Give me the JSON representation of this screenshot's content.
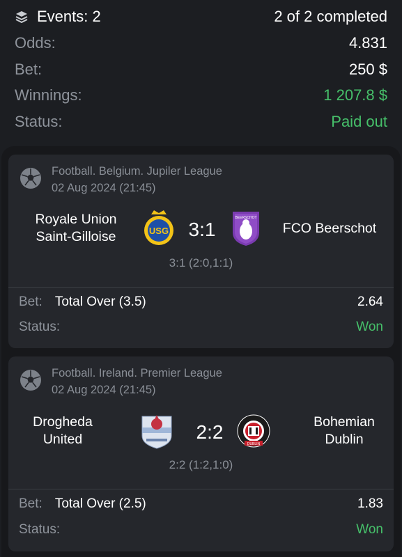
{
  "summary": {
    "events_label": "Events: 2",
    "completed": "2 of 2 completed",
    "odds_label": "Odds:",
    "odds_value": "4.831",
    "bet_label": "Bet:",
    "bet_value": "250 $",
    "winnings_label": "Winnings:",
    "winnings_value": "1 207.8 $",
    "status_label": "Status:",
    "status_value": "Paid out"
  },
  "colors": {
    "accent_green": "#46c06a",
    "muted": "#8e939b",
    "card": "#25272c",
    "background": "#1c1e22"
  },
  "events": [
    {
      "league": "Football. Belgium. Jupiler League",
      "date": "02 Aug 2024 (21:45)",
      "home_line1": "Royale Union",
      "home_line2": "Saint-Gilloise",
      "away_line1": "FCO Beerschot",
      "away_line2": "",
      "home_logo_text": "USG",
      "away_logo_text": "BEERSCHOT",
      "score": "3:1",
      "score_detail": "3:1 (2:0,1:1)",
      "bet_label": "Bet:",
      "bet_type": "Total Over (3.5)",
      "odds": "2.64",
      "status_label": "Status:",
      "status": "Won"
    },
    {
      "league": "Football. Ireland. Premier League",
      "date": "02 Aug 2024 (21:45)",
      "home_line1": "Drogheda",
      "home_line2": "United",
      "away_line1": "Bohemian",
      "away_line2": "Dublin",
      "home_logo_text": "",
      "away_logo_text": "DUBLIN",
      "score": "2:2",
      "score_detail": "2:2 (1:2,1:0)",
      "bet_label": "Bet:",
      "bet_type": "Total Over (2.5)",
      "odds": "1.83",
      "status_label": "Status:",
      "status": "Won"
    }
  ]
}
